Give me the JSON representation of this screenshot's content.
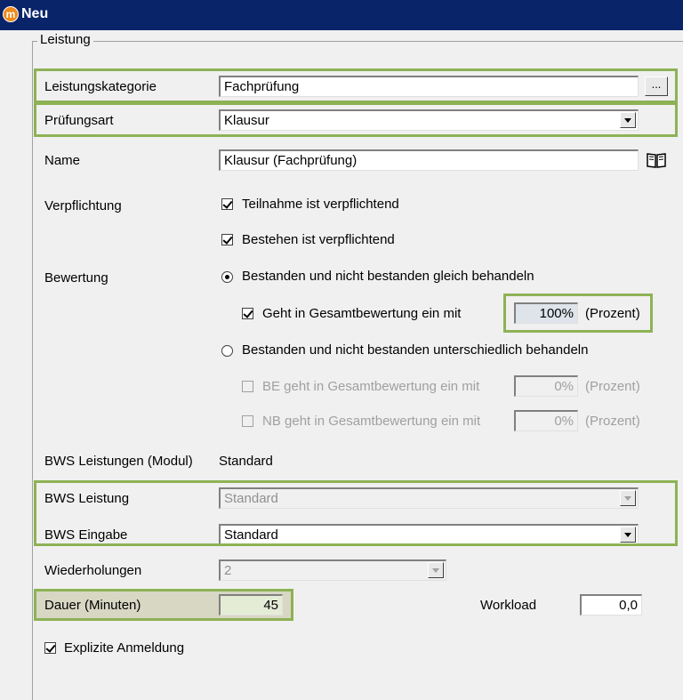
{
  "window": {
    "title": "Neu"
  },
  "group": {
    "legend": "Leistung"
  },
  "fields": {
    "leistungskategorie": {
      "label": "Leistungskategorie",
      "value": "Fachprüfung",
      "button": "..."
    },
    "pruefungsart": {
      "label": "Prüfungsart",
      "value": "Klausur"
    },
    "name": {
      "label": "Name",
      "value": "Klausur (Fachprüfung)"
    }
  },
  "verpflichtung": {
    "label": "Verpflichtung",
    "teilnahme": "Teilnahme ist verpflichtend",
    "bestehen": "Bestehen ist verpflichtend"
  },
  "bewertung": {
    "label": "Bewertung",
    "option_gleich": "Bestanden und nicht bestanden gleich behandeln",
    "gesamt_label": "Geht in Gesamtbewertung ein mit",
    "gesamt_value": "100%",
    "prozent": "(Prozent)",
    "option_unterschiedlich": "Bestanden und nicht bestanden unterschiedlich behandeln",
    "be_label": "BE geht in Gesamtbewertung ein mit",
    "be_value": "0%",
    "nb_label": "NB geht in Gesamtbewertung ein mit",
    "nb_value": "0%"
  },
  "bws": {
    "modul_label": "BWS Leistungen (Modul)",
    "modul_value": "Standard",
    "leistung_label": "BWS Leistung",
    "leistung_value": "Standard",
    "eingabe_label": "BWS Eingabe",
    "eingabe_value": "Standard"
  },
  "wiederholungen": {
    "label": "Wiederholungen",
    "value": "2"
  },
  "dauer": {
    "label": "Dauer (Minuten)",
    "value": "45"
  },
  "workload": {
    "label": "Workload",
    "value": "0,0"
  },
  "explizite": {
    "label": "Explizite Anmeldung"
  },
  "colors": {
    "highlight": "#8db255",
    "titlebar": "#0a246a"
  }
}
